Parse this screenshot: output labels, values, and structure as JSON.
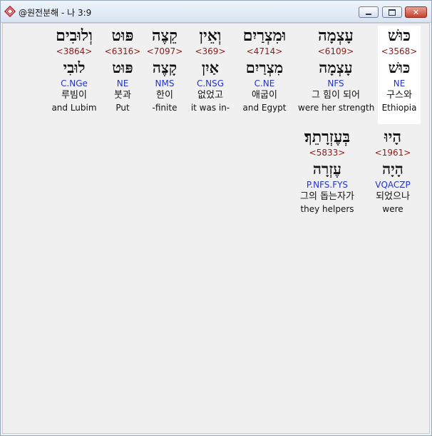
{
  "window": {
    "title": "@원전분해 - 나 3:9",
    "controls": {
      "minimize": "minimize",
      "maximize": "maximize",
      "close": "✕"
    }
  },
  "rows": [
    {
      "words": [
        {
          "hebrew": "כּוּשׁ",
          "strong": "<3568>",
          "lemma": "כּוּשׁ",
          "grammar": "NE",
          "korean": "구스와",
          "english": "Ethiopia",
          "selected": true
        },
        {
          "hebrew": "עָצְמָה",
          "strong": "<6109>",
          "lemma": "עָצְמָה",
          "grammar": "NFS",
          "korean": "그 힘이 되어",
          "english": "were her strength",
          "selected": false
        },
        {
          "hebrew": "וּמִצְרַיִם",
          "strong": "<4714>",
          "lemma": "מִצְרַיִם",
          "grammar": "C.NE",
          "korean": "애굽이",
          "english": "and Egypt",
          "selected": false
        },
        {
          "hebrew": "וְאֵין",
          "strong": "<369>",
          "lemma": "אַיִן",
          "grammar": "C.NSG",
          "korean": "없었고",
          "english": "it was in-",
          "selected": false
        },
        {
          "hebrew": "קֵצֶה",
          "strong": "<7097>",
          "lemma": "קָצֶה",
          "grammar": "NMS",
          "korean": "한이",
          "english": "-finite",
          "selected": false
        },
        {
          "hebrew": "פּוּט",
          "strong": "<6316>",
          "lemma": "פּוּט",
          "grammar": "NE",
          "korean": "붓과",
          "english": "Put",
          "selected": false
        },
        {
          "hebrew": "וְלוּבִים",
          "strong": "<3864>",
          "lemma": "לוּבִי",
          "grammar": "C.NGe",
          "korean": "루빔이",
          "english": "and Lubim",
          "selected": false
        }
      ]
    },
    {
      "words": [
        {
          "hebrew": "הָיוּ",
          "strong": "<1961>",
          "lemma": "הָיָה",
          "grammar": "VQACZP",
          "korean": "되었으나",
          "english": "were",
          "selected": false
        },
        {
          "hebrew": "בְּעֶזְרָתֵךְ׃",
          "strong": "<5833>",
          "lemma": "עֶזְרָה",
          "grammar": "P.NFS.FYS",
          "korean": "그의 돕는자가",
          "english": "they helpers",
          "selected": false
        }
      ]
    }
  ]
}
